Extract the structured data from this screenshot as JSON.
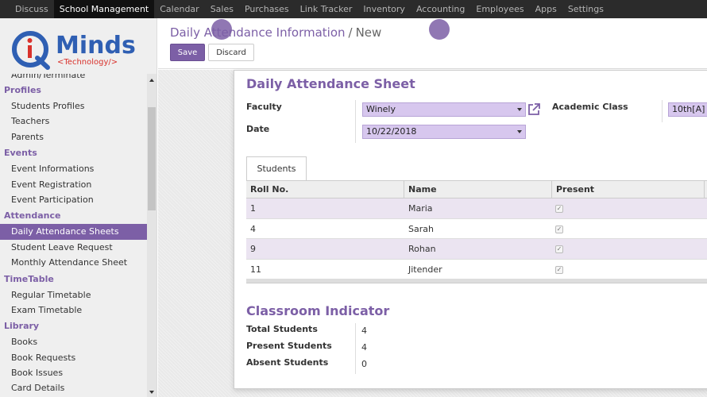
{
  "topnav": {
    "items": [
      "Discuss",
      "School Management",
      "Calendar",
      "Sales",
      "Purchases",
      "Link Tracker",
      "Inventory",
      "Accounting",
      "Employees",
      "Apps",
      "Settings"
    ]
  },
  "logo": {
    "word": "Minds",
    "tagline": "<Technology/>"
  },
  "sidebar": {
    "partial_top": "Admin/Terminate",
    "sections": [
      {
        "title": "Profiles",
        "items": [
          "Students Profiles",
          "Teachers",
          "Parents"
        ]
      },
      {
        "title": "Events",
        "items": [
          "Event Informations",
          "Event Registration",
          "Event Participation"
        ]
      },
      {
        "title": "Attendance",
        "items": [
          "Daily Attendance Sheets",
          "Student Leave Request",
          "Monthly Attendance Sheet"
        ]
      },
      {
        "title": "TimeTable",
        "items": [
          "Regular Timetable",
          "Exam Timetable"
        ]
      },
      {
        "title": "Library",
        "items": [
          "Books",
          "Book Requests",
          "Book Issues",
          "Card Details"
        ]
      }
    ]
  },
  "control": {
    "breadcrumb_parent": "Daily Attendance Information",
    "breadcrumb_sep": "/",
    "breadcrumb_current": "New",
    "save_label": "Save",
    "discard_label": "Discard"
  },
  "sheet": {
    "title": "Daily Attendance Sheet",
    "faculty_label": "Faculty",
    "faculty_value": "Winely",
    "date_label": "Date",
    "date_value": "10/22/2018",
    "academic_class_label": "Academic Class",
    "academic_class_value": "10th[A]",
    "tab_label": "Students",
    "table": {
      "headers": [
        "Roll No.",
        "Name",
        "Present"
      ],
      "rows": [
        {
          "roll": "1",
          "name": "Maria",
          "present": true
        },
        {
          "roll": "4",
          "name": "Sarah",
          "present": true
        },
        {
          "roll": "9",
          "name": "Rohan",
          "present": true
        },
        {
          "roll": "11",
          "name": "Jitender",
          "present": true
        }
      ]
    },
    "indicator": {
      "title": "Classroom Indicator",
      "total_label": "Total Students",
      "total_value": "4",
      "present_label": "Present Students",
      "present_value": "4",
      "absent_label": "Absent Students",
      "absent_value": "0"
    }
  },
  "colors": {
    "accent": "#7c5fa6",
    "nav_bg": "#2b2b2b",
    "selection_bg": "#d7c7ee"
  }
}
